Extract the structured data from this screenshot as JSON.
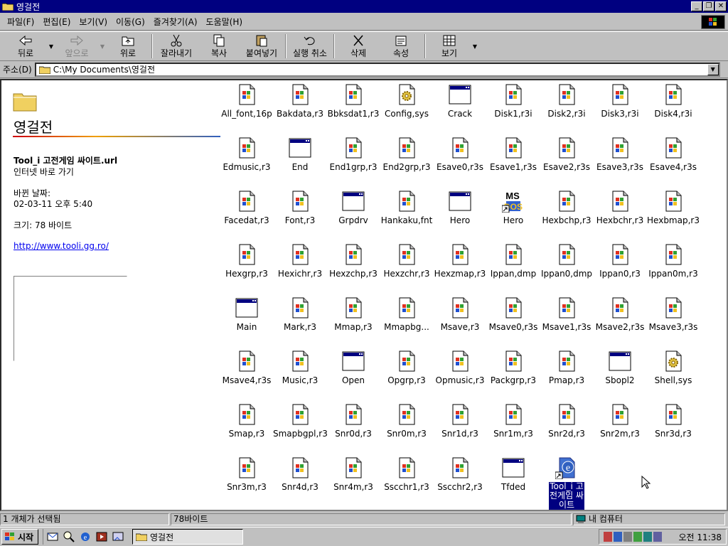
{
  "window": {
    "title": "영걸전"
  },
  "menu": [
    "파일(F)",
    "편집(E)",
    "보기(V)",
    "이동(G)",
    "즐겨찾기(A)",
    "도움말(H)"
  ],
  "toolbar": {
    "back": "뒤로",
    "forward": "앞으로",
    "up": "위로",
    "cut": "잘라내기",
    "copy": "복사",
    "paste": "붙여넣기",
    "undo": "실행 취소",
    "delete": "삭제",
    "properties": "속성",
    "view": "보기"
  },
  "address": {
    "label": "주소(D)",
    "path": "C:\\My Documents\\영걸전"
  },
  "left_pane": {
    "title": "영걸전",
    "item_name": "Tool_i 고전게임 싸이트.url",
    "item_type": "인터넷 바로 가기",
    "modified_label": "바뀐 날짜:",
    "modified_value": "02-03-11 오후 5:40",
    "size": "크기: 78 바이트",
    "link": "http://www.tooli.gg.ro/"
  },
  "files": [
    {
      "name": "All_font,16p",
      "icon": "win-doc-icon"
    },
    {
      "name": "Bakdata,r3",
      "icon": "win-doc-icon"
    },
    {
      "name": "Bbksdat1,r3",
      "icon": "win-doc-icon"
    },
    {
      "name": "Config,sys",
      "icon": "gear-doc-icon"
    },
    {
      "name": "Crack",
      "icon": "app-window-icon"
    },
    {
      "name": "Disk1,r3i",
      "icon": "win-doc-icon"
    },
    {
      "name": "Disk2,r3i",
      "icon": "win-doc-icon"
    },
    {
      "name": "Disk3,r3i",
      "icon": "win-doc-icon"
    },
    {
      "name": "Disk4,r3i",
      "icon": "win-doc-icon"
    },
    {
      "name": "Edmusic,r3",
      "icon": "win-doc-icon"
    },
    {
      "name": "End",
      "icon": "app-window-icon"
    },
    {
      "name": "End1grp,r3",
      "icon": "win-doc-icon"
    },
    {
      "name": "End2grp,r3",
      "icon": "win-doc-icon"
    },
    {
      "name": "Esave0,r3s",
      "icon": "win-doc-icon"
    },
    {
      "name": "Esave1,r3s",
      "icon": "win-doc-icon"
    },
    {
      "name": "Esave2,r3s",
      "icon": "win-doc-icon"
    },
    {
      "name": "Esave3,r3s",
      "icon": "win-doc-icon"
    },
    {
      "name": "Esave4,r3s",
      "icon": "win-doc-icon"
    },
    {
      "name": "Facedat,r3",
      "icon": "win-doc-icon"
    },
    {
      "name": "Font,r3",
      "icon": "win-doc-icon"
    },
    {
      "name": "Grpdrv",
      "icon": "app-window-icon"
    },
    {
      "name": "Hankaku,fnt",
      "icon": "win-doc-icon"
    },
    {
      "name": "Hero",
      "icon": "app-window-icon"
    },
    {
      "name": "Hero",
      "icon": "msdos-shortcut-icon"
    },
    {
      "name": "Hexbchp,r3",
      "icon": "win-doc-icon"
    },
    {
      "name": "Hexbchr,r3",
      "icon": "win-doc-icon"
    },
    {
      "name": "Hexbmap,r3",
      "icon": "win-doc-icon"
    },
    {
      "name": "Hexgrp,r3",
      "icon": "win-doc-icon"
    },
    {
      "name": "Hexichr,r3",
      "icon": "win-doc-icon"
    },
    {
      "name": "Hexzchp,r3",
      "icon": "win-doc-icon"
    },
    {
      "name": "Hexzchr,r3",
      "icon": "win-doc-icon"
    },
    {
      "name": "Hexzmap,r3",
      "icon": "win-doc-icon"
    },
    {
      "name": "Ippan,dmp",
      "icon": "win-doc-icon"
    },
    {
      "name": "Ippan0,dmp",
      "icon": "win-doc-icon"
    },
    {
      "name": "Ippan0,r3",
      "icon": "win-doc-icon"
    },
    {
      "name": "Ippan0m,r3",
      "icon": "win-doc-icon"
    },
    {
      "name": "Main",
      "icon": "app-window-icon"
    },
    {
      "name": "Mark,r3",
      "icon": "win-doc-icon"
    },
    {
      "name": "Mmap,r3",
      "icon": "win-doc-icon"
    },
    {
      "name": "Mmapbg...",
      "icon": "win-doc-icon"
    },
    {
      "name": "Msave,r3",
      "icon": "win-doc-icon"
    },
    {
      "name": "Msave0,r3s",
      "icon": "win-doc-icon"
    },
    {
      "name": "Msave1,r3s",
      "icon": "win-doc-icon"
    },
    {
      "name": "Msave2,r3s",
      "icon": "win-doc-icon"
    },
    {
      "name": "Msave3,r3s",
      "icon": "win-doc-icon"
    },
    {
      "name": "Msave4,r3s",
      "icon": "win-doc-icon"
    },
    {
      "name": "Music,r3",
      "icon": "win-doc-icon"
    },
    {
      "name": "Open",
      "icon": "app-window-icon"
    },
    {
      "name": "Opgrp,r3",
      "icon": "win-doc-icon"
    },
    {
      "name": "Opmusic,r3",
      "icon": "win-doc-icon"
    },
    {
      "name": "Packgrp,r3",
      "icon": "win-doc-icon"
    },
    {
      "name": "Pmap,r3",
      "icon": "win-doc-icon"
    },
    {
      "name": "Sbopl2",
      "icon": "app-window-icon"
    },
    {
      "name": "Shell,sys",
      "icon": "gear-doc-icon"
    },
    {
      "name": "Smap,r3",
      "icon": "win-doc-icon"
    },
    {
      "name": "Smapbgpl,r3",
      "icon": "win-doc-icon"
    },
    {
      "name": "Snr0d,r3",
      "icon": "win-doc-icon"
    },
    {
      "name": "Snr0m,r3",
      "icon": "win-doc-icon"
    },
    {
      "name": "Snr1d,r3",
      "icon": "win-doc-icon"
    },
    {
      "name": "Snr1m,r3",
      "icon": "win-doc-icon"
    },
    {
      "name": "Snr2d,r3",
      "icon": "win-doc-icon"
    },
    {
      "name": "Snr2m,r3",
      "icon": "win-doc-icon"
    },
    {
      "name": "Snr3d,r3",
      "icon": "win-doc-icon"
    },
    {
      "name": "Snr3m,r3",
      "icon": "win-doc-icon"
    },
    {
      "name": "Snr4d,r3",
      "icon": "win-doc-icon"
    },
    {
      "name": "Snr4m,r3",
      "icon": "win-doc-icon"
    },
    {
      "name": "Sscchr1,r3",
      "icon": "win-doc-icon"
    },
    {
      "name": "Sscchr2,r3",
      "icon": "win-doc-icon"
    },
    {
      "name": "Tfded",
      "icon": "app-window-icon"
    },
    {
      "name": "Tool_i 고전게임 싸이트",
      "icon": "ie-shortcut-icon",
      "selected": true
    }
  ],
  "status": {
    "selection": "1 개체가 선택됨",
    "size": "78바이트",
    "zone": "내 컴퓨터"
  },
  "taskbar": {
    "start": "시작",
    "task": "영걸전",
    "clock": "오전 11:38"
  },
  "colors": {
    "title_bar": "#000080",
    "selection": "#000080",
    "face": "#c0c0c0"
  }
}
